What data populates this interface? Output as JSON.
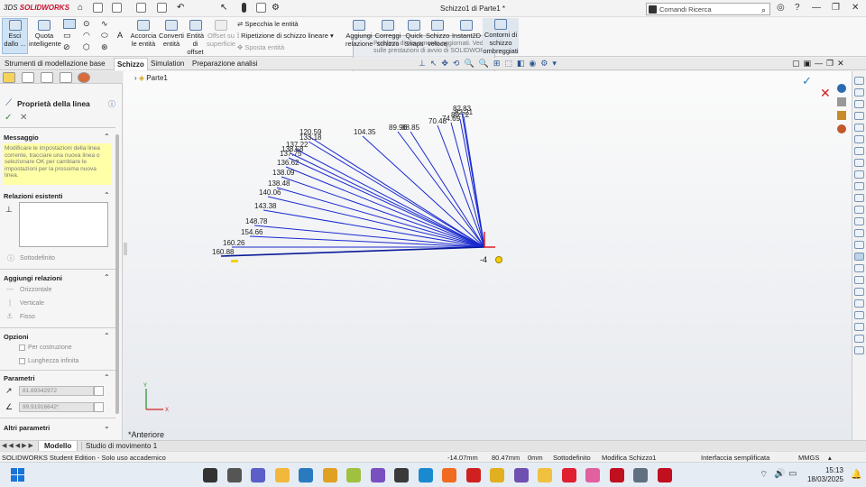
{
  "app": {
    "logo_brand": "3DS",
    "logo_text": "SOLIDWORKS",
    "doc_title": "Schizzo1 di Parte1 *",
    "search_placeholder": "Comandi Ricerca"
  },
  "ribbon": {
    "esci_label": "Esci dallo ...",
    "quota_label": "Quota intelligente",
    "accorcia_label": "Accorcia le entità",
    "converti_label": "Converti entità",
    "offset_label": "Entità di offset",
    "offset_sup_label": "Offset su superficie",
    "specchia_label": "Specchia le entità",
    "ripetizione_label": "Ripetizione di schizzo lineare",
    "sposta_label": "Sposta entità",
    "aggiungi_label": "Aggiungi relazione",
    "correggi_label": "Correggi schizzo",
    "quick_label": "Quick Snaps",
    "schizzo_veloce_label": "Schizzo veloce",
    "instant2d_label": "Instant2D",
    "contorni_label": "Contorni di schizzo ombreggiati",
    "tooltip_text": "Problemi di rilevamento aggiornati. Vedere sulle prestazioni di avvio di SOLIDWORKS"
  },
  "tabs": [
    "Strumenti di modellazione base",
    "Schizzo",
    "Simulation",
    "Preparazione analisi"
  ],
  "active_tab": "Schizzo",
  "tree": {
    "part_name": "Parte1"
  },
  "property_manager": {
    "title": "Proprietà della linea",
    "messaggio_header": "Messaggio",
    "messaggio_text": "Modificare le impostazioni della linea corrente, tracciare una nuova linea o selezionare OK per cambiare le impostazioni per la prossima nuova linea.",
    "relazioni_header": "Relazioni esistenti",
    "sottodefinito": "Sottodefinito",
    "aggiungi_header": "Aggiungi relazioni",
    "rel_orizzontale": "Orizzontale",
    "rel_verticale": "Verticale",
    "rel_fisso": "Fisso",
    "opzioni_header": "Opzioni",
    "opt_costruzione": "Per costruzione",
    "opt_infinita": "Lunghezza infinita",
    "parametri_header": "Parametri",
    "param_length": "81.69342972",
    "param_angle": "99.91916642°",
    "altri_header": "Altri parametri"
  },
  "viewport": {
    "view_label": "*Anteriore",
    "cursor_label": "-4",
    "dimension_labels": [
      "82.83",
      "82.21",
      "80.72",
      "74.69",
      "70.48",
      "88.85",
      "89.96",
      "104.35",
      "120.59",
      "133.18",
      "137.22",
      "138.58",
      "137.75",
      "136.62",
      "138.09",
      "138.48",
      "140.06",
      "143.38",
      "148.78",
      "154.66",
      "160.26",
      "160.88"
    ]
  },
  "bottom_tabs": [
    "Modello",
    "Studio di movimento 1"
  ],
  "status": {
    "edition": "SOLIDWORKS Student Edition - Solo uso accademico",
    "x": "-14.07mm",
    "y": "80.47mm",
    "z": "0mm",
    "state": "Sottodefinito",
    "editing": "Modifica Schizzo1",
    "interface": "Interfaccia semplificata",
    "units": "MMGS"
  },
  "taskbar": {
    "time": "15:13",
    "date": "18/03/2025"
  }
}
